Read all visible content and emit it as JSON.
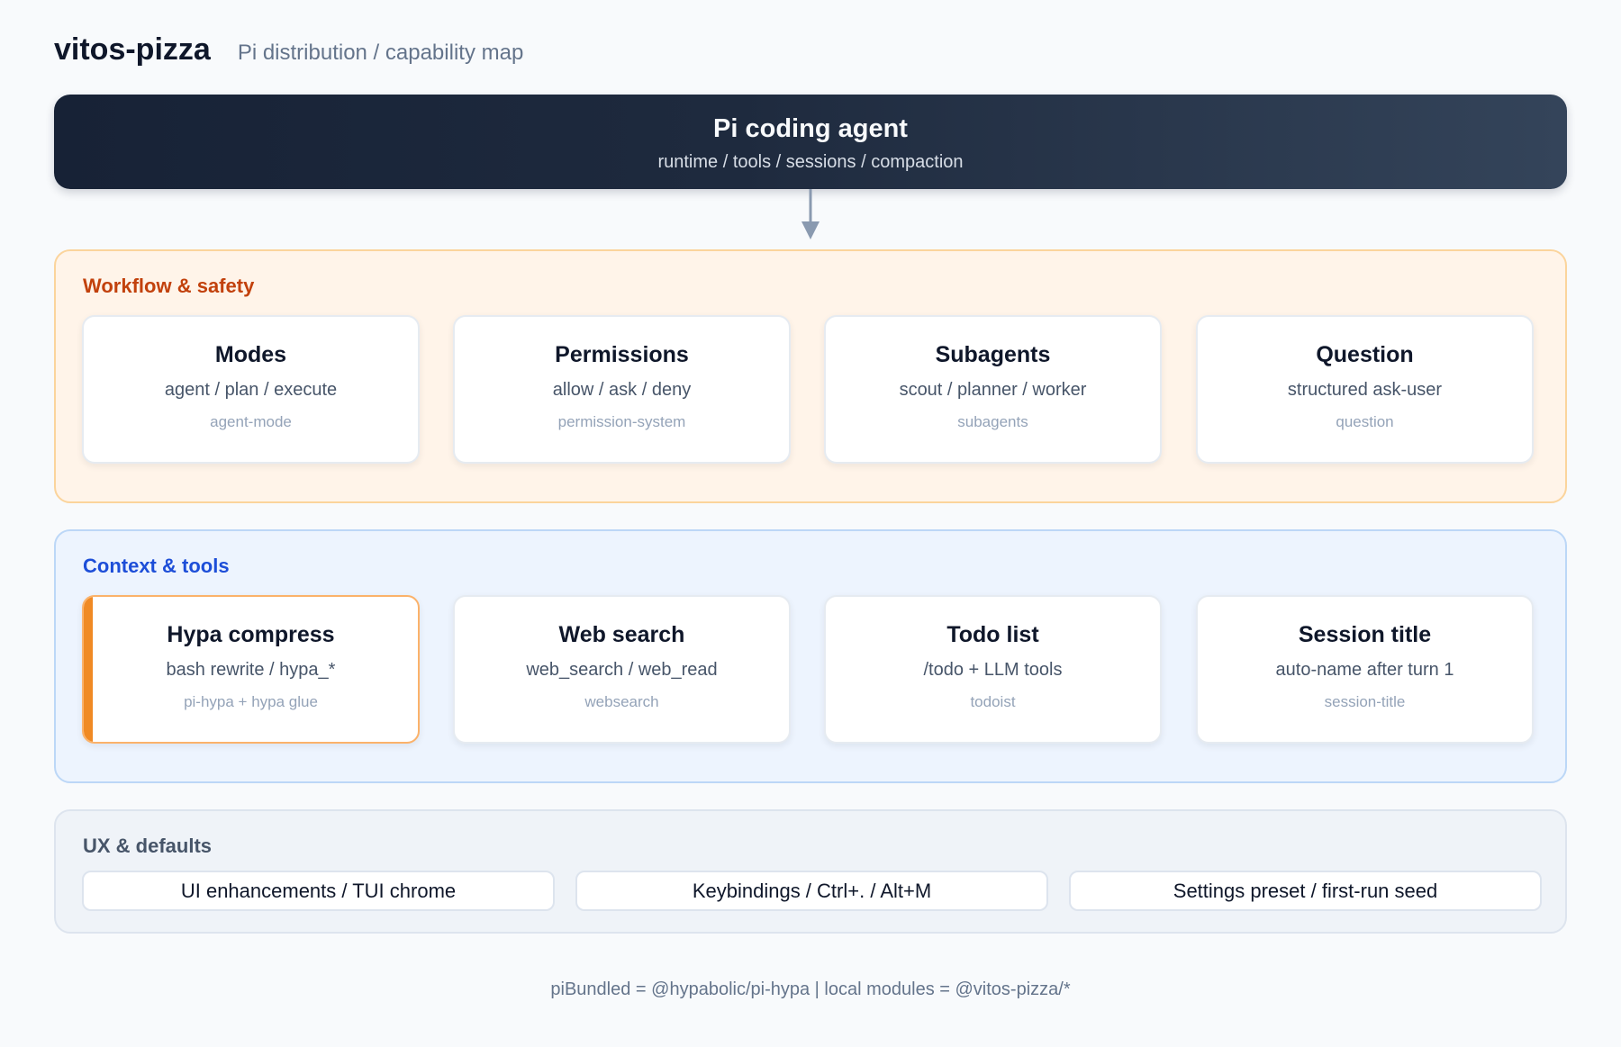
{
  "header": {
    "brand": "vitos-pizza",
    "subtitle": "Pi distribution / capability map"
  },
  "agent": {
    "title": "Pi coding agent",
    "subtitle": "runtime / tools / sessions / compaction"
  },
  "sections": {
    "workflow": {
      "title": "Workflow & safety",
      "cards": [
        {
          "title": "Modes",
          "subtitle": "agent / plan / execute",
          "module": "agent-mode"
        },
        {
          "title": "Permissions",
          "subtitle": "allow / ask / deny",
          "module": "permission-system"
        },
        {
          "title": "Subagents",
          "subtitle": "scout / planner / worker",
          "module": "subagents"
        },
        {
          "title": "Question",
          "subtitle": "structured ask-user",
          "module": "question"
        }
      ]
    },
    "context": {
      "title": "Context & tools",
      "cards": [
        {
          "title": "Hypa compress",
          "subtitle": "bash rewrite / hypa_*",
          "module": "pi-hypa + hypa glue"
        },
        {
          "title": "Web search",
          "subtitle": "web_search / web_read",
          "module": "websearch"
        },
        {
          "title": "Todo list",
          "subtitle": "/todo + LLM tools",
          "module": "todoist"
        },
        {
          "title": "Session title",
          "subtitle": "auto-name after turn 1",
          "module": "session-title"
        }
      ]
    },
    "ux": {
      "title": "UX & defaults",
      "items": [
        "UI enhancements / TUI chrome",
        "Keybindings / Ctrl+. / Alt+M",
        "Settings preset / first-run seed"
      ]
    }
  },
  "footer": "piBundled = @hypabolic/pi-hypa | local modules = @vitos-pizza/*",
  "colors": {
    "workflow_accent": "#c2410c",
    "context_accent": "#1d4ed8",
    "highlight_bar": "#f08a24",
    "agent_bar": "#1e2a3e"
  }
}
